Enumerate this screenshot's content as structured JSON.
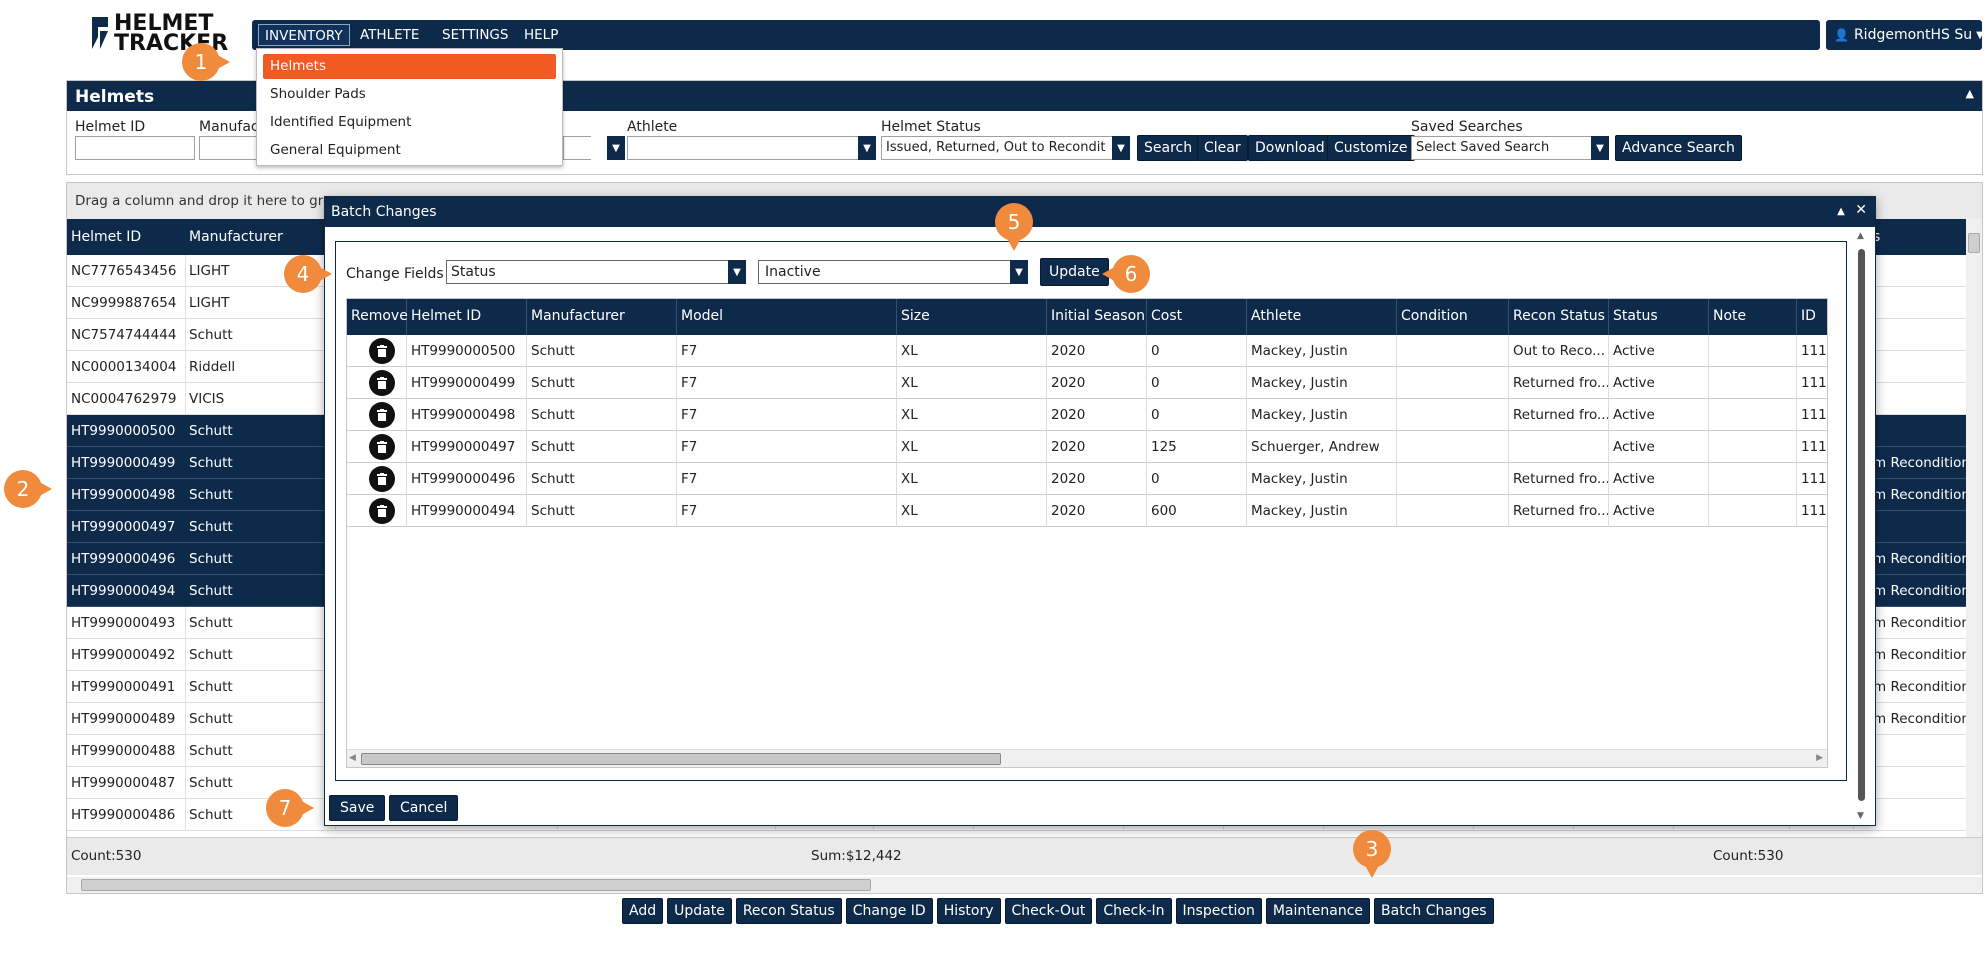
{
  "app": {
    "logo_line1": "HELMET",
    "logo_line2": "TRACKER",
    "user_label": "RidgemontHS Su"
  },
  "nav": {
    "items": [
      "INVENTORY",
      "ATHLETE",
      "SETTINGS",
      "HELP"
    ],
    "inventory_menu": [
      "Helmets",
      "Shoulder Pads",
      "Identified Equipment",
      "General Equipment"
    ]
  },
  "panel": {
    "title": "Helmets",
    "filters": {
      "helmet_id": "Helmet ID",
      "manufacturer": "Manufact",
      "athlete": "Athlete",
      "helmet_status": "Helmet Status",
      "helmet_status_value": "Issued, Returned, Out to Recondit",
      "saved_searches": "Saved Searches",
      "saved_searches_placeholder": "Select Saved Search"
    },
    "buttons": [
      "Search",
      "Clear",
      "Download",
      "Customize",
      "Advance Search"
    ]
  },
  "grid": {
    "group_hint": "Drag a column and drop it here to gro",
    "col_helmet_id": "Helmet ID",
    "col_manufacturer": "Manufacturer",
    "col_right_fragment": "s",
    "rows": [
      {
        "id": "NC7776543456",
        "mfr": "LIGHT",
        "selected": false,
        "right": ""
      },
      {
        "id": "NC9999887654",
        "mfr": "LIGHT",
        "selected": false,
        "right": ""
      },
      {
        "id": "NC7574744444",
        "mfr": "Schutt",
        "selected": false,
        "right": ""
      },
      {
        "id": "NC0000134004",
        "mfr": "Riddell",
        "selected": false,
        "right": ""
      },
      {
        "id": "NC0004762979",
        "mfr": "VICIS",
        "selected": false,
        "right": ""
      },
      {
        "id": "HT9990000500",
        "mfr": "Schutt",
        "selected": true,
        "right": ""
      },
      {
        "id": "HT9990000499",
        "mfr": "Schutt",
        "selected": true,
        "right": "m Recondition"
      },
      {
        "id": "HT9990000498",
        "mfr": "Schutt",
        "selected": true,
        "right": "m Recondition"
      },
      {
        "id": "HT9990000497",
        "mfr": "Schutt",
        "selected": true,
        "right": ""
      },
      {
        "id": "HT9990000496",
        "mfr": "Schutt",
        "selected": true,
        "right": "m Recondition"
      },
      {
        "id": "HT9990000494",
        "mfr": "Schutt",
        "selected": true,
        "right": "m Recondition"
      },
      {
        "id": "HT9990000493",
        "mfr": "Schutt",
        "selected": false,
        "right": "m Recondition"
      },
      {
        "id": "HT9990000492",
        "mfr": "Schutt",
        "selected": false,
        "right": "m Recondition"
      },
      {
        "id": "HT9990000491",
        "mfr": "Schutt",
        "selected": false,
        "right": "m Recondition"
      },
      {
        "id": "HT9990000489",
        "mfr": "Schutt",
        "selected": false,
        "right": "m Recondition"
      },
      {
        "id": "HT9990000488",
        "mfr": "Schutt",
        "selected": false,
        "right": ""
      },
      {
        "id": "HT9990000487",
        "mfr": "Schutt",
        "selected": false,
        "right": ""
      },
      {
        "id": "HT9990000486",
        "mfr": "Schutt",
        "selected": false,
        "right": ""
      }
    ],
    "footer_count": "Count:530",
    "footer_sum": "Sum:$12,442",
    "footer_count2": "Count:530"
  },
  "actions": [
    "Add",
    "Update",
    "Recon Status",
    "Change ID",
    "History",
    "Check-Out",
    "Check-In",
    "Inspection",
    "Maintenance",
    "Batch Changes"
  ],
  "modal": {
    "title": "Batch Changes",
    "change_fields_label": "Change Fields",
    "field_value": "Status",
    "new_value": "Inactive",
    "update_label": "Update",
    "save_label": "Save",
    "cancel_label": "Cancel",
    "columns": [
      "Remove",
      "Helmet ID",
      "Manufacturer",
      "Model",
      "Size",
      "Initial Season",
      "Cost",
      "Athlete",
      "Condition",
      "Recon Status",
      "Status",
      "Note",
      "ID"
    ],
    "rows": [
      [
        "HT9990000500",
        "Schutt",
        "F7",
        "XL",
        "2020",
        "0",
        "Mackey, Justin",
        "",
        "Out to Reco...",
        "Active",
        "",
        "111"
      ],
      [
        "HT9990000499",
        "Schutt",
        "F7",
        "XL",
        "2020",
        "0",
        "Mackey, Justin",
        "",
        "Returned fro...",
        "Active",
        "",
        "111"
      ],
      [
        "HT9990000498",
        "Schutt",
        "F7",
        "XL",
        "2020",
        "0",
        "Mackey, Justin",
        "",
        "Returned fro...",
        "Active",
        "",
        "111"
      ],
      [
        "HT9990000497",
        "Schutt",
        "F7",
        "XL",
        "2020",
        "125",
        "Schuerger, Andrew",
        "",
        "",
        "Active",
        "",
        "111"
      ],
      [
        "HT9990000496",
        "Schutt",
        "F7",
        "XL",
        "2020",
        "0",
        "Mackey, Justin",
        "",
        "Returned fro...",
        "Active",
        "",
        "111"
      ],
      [
        "HT9990000494",
        "Schutt",
        "F7",
        "XL",
        "2020",
        "600",
        "Mackey, Justin",
        "",
        "Returned fro...",
        "Active",
        "",
        "111"
      ]
    ]
  },
  "callouts": [
    "1",
    "2",
    "3",
    "4",
    "5",
    "6",
    "7"
  ],
  "colors": {
    "navy": "#0e2a4b",
    "accent_orange": "#f15a22",
    "callout_orange": "#f08a3c"
  }
}
